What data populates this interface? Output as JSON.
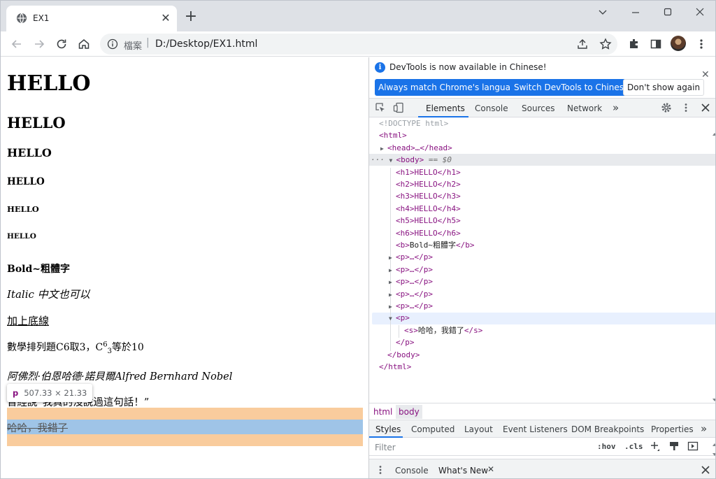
{
  "browser": {
    "tab_title": "EX1",
    "new_tab": "+",
    "omnibox": {
      "scheme": "檔案",
      "url": "D:/Desktop/EX1.html"
    }
  },
  "page": {
    "h1": "HELLO",
    "h2": "HELLO",
    "h3": "HELLO",
    "h4": "HELLO",
    "h5": "HELLO",
    "h6": "HELLO",
    "bold": "Bold~粗體字",
    "italic": "Italic 中文也可以",
    "underline": "加上底線",
    "math_a": "數學排列題C6取3，C",
    "math_sup": "6",
    "math_sub": "3",
    "math_b": "等於10",
    "name": "阿佛烈·伯恩哈德·諾貝爾Alfred Bernhard Nobel",
    "quote": "曾經說“我真的沒說過這句話！”",
    "strike": "哈哈，我錯了",
    "tooltip": {
      "tag": "p",
      "dims": "507.33 × 21.33"
    }
  },
  "devtools": {
    "infobar": {
      "message": "DevTools is now available in Chinese!",
      "btn_match": "Always match Chrome's language",
      "btn_switch": "Switch DevTools to Chinese",
      "btn_dismiss": "Don't show again"
    },
    "tabs": [
      "Elements",
      "Console",
      "Sources",
      "Network"
    ],
    "dom": {
      "doctype": "<!DOCTYPE html>",
      "html_open": "<html>",
      "head": "<head>…</head>",
      "body_open": "<body>",
      "body_eq": " == $0",
      "h1": "<h1>HELLO</h1>",
      "h2": "<h2>HELLO</h2>",
      "h3": "<h3>HELLO</h3>",
      "h4": "<h4>HELLO</h4>",
      "h5": "<h5>HELLO</h5>",
      "h6": "<h6>HELLO</h6>",
      "b_open": "<b>",
      "b_text": "Bold~粗體字",
      "b_close": "</b>",
      "p_collapsed": "<p>…</p>",
      "p_open": "<p>",
      "s_open": "<s>",
      "s_text": "哈哈，我錯了",
      "s_close": "</s>",
      "p_close": "</p>",
      "body_close": "</body>",
      "html_close": "</html>"
    },
    "breadcrumbs": [
      "html",
      "body"
    ],
    "styles_tabs": [
      "Styles",
      "Computed",
      "Layout",
      "Event Listeners",
      "DOM Breakpoints",
      "Properties"
    ],
    "filter_placeholder": "Filter",
    "hov": ":hov",
    "cls": ".cls",
    "drawer_tabs": [
      "Console",
      "What's New"
    ]
  },
  "colors": {
    "accent": "#1a73e8",
    "tag": "#881280",
    "margin_highlight": "#f9cc9d",
    "content_highlight": "#9fc4e7"
  }
}
